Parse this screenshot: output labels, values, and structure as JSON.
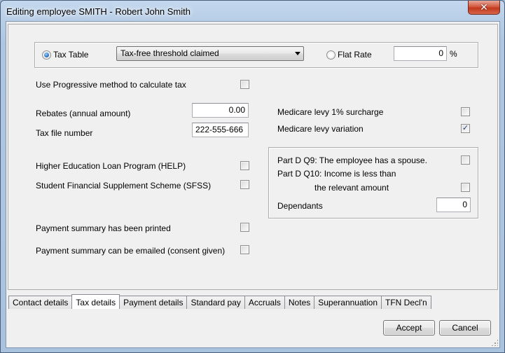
{
  "window": {
    "title": "Editing employee SMITH - Robert John Smith",
    "close_glyph": "✕"
  },
  "tax_method": {
    "tax_table_label": "Tax Table",
    "tax_table_selected": true,
    "table_option": "Tax-free threshold claimed",
    "flat_rate_label": "Flat Rate",
    "flat_rate_value": "0",
    "percent_sign": "%"
  },
  "progressive": {
    "label": "Use Progressive method to calculate tax",
    "checked": false
  },
  "rebates": {
    "label": "Rebates (annual amount)",
    "value": "0.00"
  },
  "tfn": {
    "label": "Tax file number",
    "value": "222-555-666"
  },
  "medicare": {
    "surcharge_label": "Medicare levy 1% surcharge",
    "surcharge_checked": false,
    "variation_label": "Medicare levy variation",
    "variation_checked": true
  },
  "help": {
    "label": "Higher Education Loan Program (HELP)",
    "checked": false
  },
  "sfss": {
    "label": "Student Financial Supplement Scheme (SFSS)",
    "checked": false
  },
  "partd": {
    "q9_label": "Part D Q9: The employee has a spouse.",
    "q10_label_line1": "Part D Q10: Income is less than",
    "q10_label_line2": "the relevant amount",
    "dependants_label": "Dependants",
    "dependants_value": "0"
  },
  "payment_summary": {
    "printed_label": "Payment summary has been printed",
    "emailed_label": "Payment summary can be emailed (consent given)"
  },
  "tabs": [
    "Contact details",
    "Tax details",
    "Payment details",
    "Standard pay",
    "Accruals",
    "Notes",
    "Superannuation",
    "TFN Decl'n"
  ],
  "active_tab": "Tax details",
  "buttons": {
    "accept": "Accept",
    "cancel": "Cancel"
  },
  "check_glyph": "✓"
}
